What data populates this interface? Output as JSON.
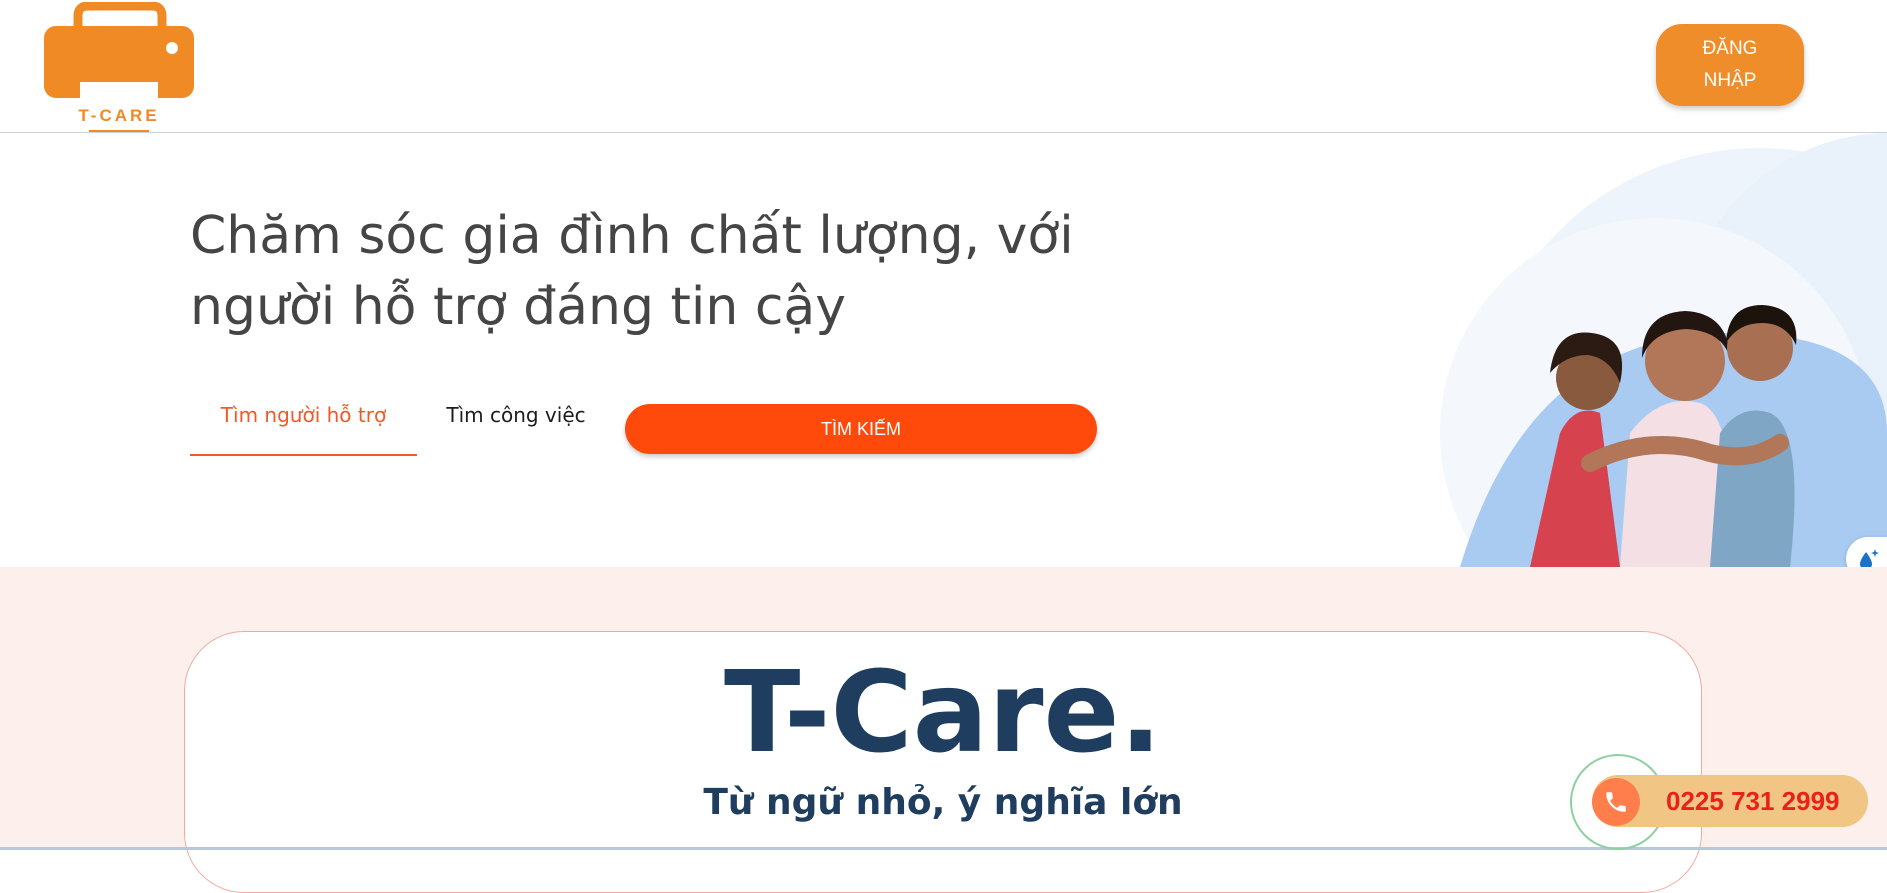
{
  "header": {
    "logo_text": "T-CARE",
    "login_label": "ĐĂNG NHẬP"
  },
  "hero": {
    "title": "Chăm sóc gia đình chất lượng, với người hỗ trợ đáng tin cậy",
    "tabs": [
      {
        "label": "Tìm người hỗ trợ",
        "active": true
      },
      {
        "label": "Tìm công việc",
        "active": false
      }
    ],
    "search_label": "TÌM KIẾM"
  },
  "brand": {
    "title": "T-Care.",
    "subtitle": "Từ ngữ nhỏ, ý nghĩa lớn"
  },
  "contact": {
    "phone": "0225 731 2999",
    "icon": "phone-icon"
  },
  "colors": {
    "brand_orange": "#f08a24",
    "accent_red": "#ff4a0c",
    "navy": "#1f3e5f",
    "section_bg": "#fdf0ec",
    "hero_blue": "#a9cbf2"
  }
}
